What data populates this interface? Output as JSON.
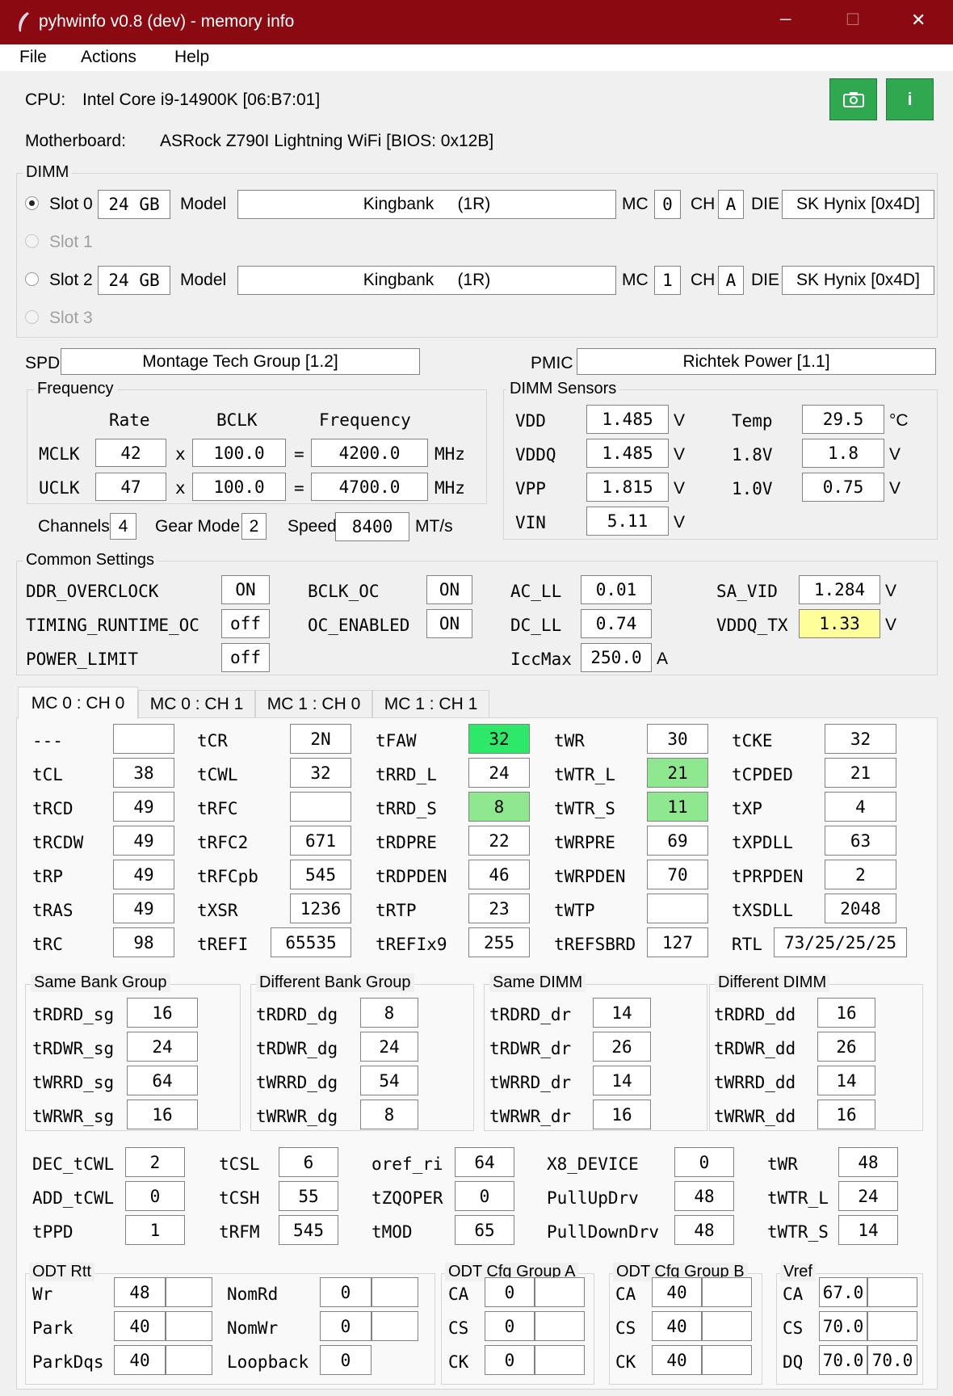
{
  "window": {
    "title": "pyhwinfo v0.8 (dev) - memory info",
    "min": "─",
    "max": "☐",
    "close": "✕"
  },
  "menu": [
    "File",
    "Actions",
    "Help"
  ],
  "cpu": {
    "label": "CPU:",
    "value": "Intel Core i9-14900K  [06:B7:01]"
  },
  "board": {
    "label": "Motherboard:",
    "value": "ASRock Z790I Lightning WiFi  [BIOS: 0x12B]"
  },
  "buttons": {
    "screenshot_icon": "camera-icon",
    "info_label": "i",
    "color": "#2fa84f"
  },
  "dimm": {
    "title": "DIMM",
    "slots": [
      {
        "label": "Slot 0",
        "size": "24  GB",
        "model_label": "Model",
        "model": "Kingbank     (1R)",
        "mc_label": "MC",
        "mc": "0",
        "ch_label": "CH",
        "ch": "A",
        "die_label": "DIE",
        "die": "SK Hynix [0x4D]"
      },
      {
        "label": "Slot 1"
      },
      {
        "label": "Slot 2",
        "size": "24  GB",
        "model_label": "Model",
        "model": "Kingbank     (1R)",
        "mc_label": "MC",
        "mc": "1",
        "ch_label": "CH",
        "ch": "A",
        "die_label": "DIE",
        "die": "SK Hynix [0x4D]"
      },
      {
        "label": "Slot 3"
      }
    ]
  },
  "spd": {
    "label": "SPD",
    "value": "Montage Tech Group [1.2]"
  },
  "pmic": {
    "label": "PMIC",
    "value": "Richtek Power [1.1]"
  },
  "freq": {
    "title": "Frequency",
    "h_rate": "Rate",
    "h_bclk": "BCLK",
    "h_freq": "Frequency",
    "x": "x",
    "eq": "=",
    "unit": "MHz",
    "rows": [
      {
        "label": "MCLK",
        "rate": "42",
        "bclk": "100.0",
        "freq": "4200.0"
      },
      {
        "label": "UCLK",
        "rate": "47",
        "bclk": "100.0",
        "freq": "4700.0"
      }
    ],
    "channels_label": "Channels",
    "channels": "4",
    "gear_label": "Gear Mode",
    "gear": "2",
    "speed_label": "Speed",
    "speed": "8400",
    "speed_unit": "MT/s"
  },
  "sensors": {
    "title": "DIMM Sensors",
    "left": [
      {
        "l": "VDD",
        "v": "1.485",
        "u": "V"
      },
      {
        "l": "VDDQ",
        "v": "1.485",
        "u": "V"
      },
      {
        "l": "VPP",
        "v": "1.815",
        "u": "V"
      },
      {
        "l": "VIN",
        "v": "5.11",
        "u": "V"
      }
    ],
    "right": [
      {
        "l": "Temp",
        "v": "29.5",
        "u": "°C"
      },
      {
        "l": "1.8V",
        "v": "1.8",
        "u": "V"
      },
      {
        "l": "1.0V",
        "v": "0.75",
        "u": "V"
      }
    ]
  },
  "common": {
    "title": "Common Settings",
    "ddr_oc": {
      "l": "DDR_OVERCLOCK",
      "v": "ON"
    },
    "trt": {
      "l": "TIMING_RUNTIME_OC",
      "v": "off"
    },
    "pl": {
      "l": "POWER_LIMIT",
      "v": "off"
    },
    "bclk": {
      "l": "BCLK_OC",
      "v": "ON"
    },
    "oce": {
      "l": "OC_ENABLED",
      "v": "ON"
    },
    "acll": {
      "l": "AC_LL",
      "v": "0.01"
    },
    "dcll": {
      "l": "DC_LL",
      "v": "0.74"
    },
    "icc": {
      "l": "IccMax",
      "v": "250.0",
      "u": "A"
    },
    "savid": {
      "l": "SA_VID",
      "v": "1.284",
      "u": "V"
    },
    "vddqtx": {
      "l": "VDDQ_TX",
      "v": "1.33",
      "u": "V",
      "color": "#ffff99"
    }
  },
  "tabs": [
    "MC 0 : CH 0",
    "MC 0 : CH 1",
    "MC 1 : CH 0",
    "MC 1 : CH 1"
  ],
  "timings": [
    [
      {
        "l": "---",
        "v": ""
      },
      {
        "l": "tCL",
        "v": "38"
      },
      {
        "l": "tRCD",
        "v": "49"
      },
      {
        "l": "tRCDW",
        "v": "49"
      },
      {
        "l": "tRP",
        "v": "49"
      },
      {
        "l": "tRAS",
        "v": "49"
      },
      {
        "l": "tRC",
        "v": "98"
      }
    ],
    [
      {
        "l": "tCR",
        "v": "2N"
      },
      {
        "l": "tCWL",
        "v": "32"
      },
      {
        "l": "tRFC",
        "v": ""
      },
      {
        "l": "tRFC2",
        "v": "671"
      },
      {
        "l": "tRFCpb",
        "v": "545"
      },
      {
        "l": "tXSR",
        "v": "1236"
      },
      {
        "l": "tREFI",
        "v": "65535"
      }
    ],
    [
      {
        "l": "tFAW",
        "v": "32",
        "hl": "#2ee86a"
      },
      {
        "l": "tRRD_L",
        "v": "24"
      },
      {
        "l": "tRRD_S",
        "v": "8",
        "hl": "#8fe88f"
      },
      {
        "l": "tRDPRE",
        "v": "22"
      },
      {
        "l": "tRDPDEN",
        "v": "46"
      },
      {
        "l": "tRTP",
        "v": "23"
      },
      {
        "l": "tREFIx9",
        "v": "255"
      }
    ],
    [
      {
        "l": "tWR",
        "v": "30"
      },
      {
        "l": "tWTR_L",
        "v": "21",
        "hl": "#8fe88f"
      },
      {
        "l": "tWTR_S",
        "v": "11",
        "hl": "#8fe88f"
      },
      {
        "l": "tWRPRE",
        "v": "69"
      },
      {
        "l": "tWRPDEN",
        "v": "70"
      },
      {
        "l": "tWTP",
        "v": ""
      },
      {
        "l": "tREFSBRD",
        "v": "127"
      }
    ],
    [
      {
        "l": "tCKE",
        "v": "32"
      },
      {
        "l": "tCPDED",
        "v": "21"
      },
      {
        "l": "tXP",
        "v": "4"
      },
      {
        "l": "tXPDLL",
        "v": "63"
      },
      {
        "l": "tPRPDEN",
        "v": "2"
      },
      {
        "l": "tXSDLL",
        "v": "2048"
      },
      {
        "l": "RTL",
        "v": "73/25/25/25"
      }
    ]
  ],
  "turn": [
    {
      "title": "Same Bank Group",
      "rows": [
        {
          "l": "tRDRD_sg",
          "v": "16"
        },
        {
          "l": "tRDWR_sg",
          "v": "24"
        },
        {
          "l": "tWRRD_sg",
          "v": "64"
        },
        {
          "l": "tWRWR_sg",
          "v": "16"
        }
      ]
    },
    {
      "title": "Different Bank Group",
      "rows": [
        {
          "l": "tRDRD_dg",
          "v": "8"
        },
        {
          "l": "tRDWR_dg",
          "v": "24"
        },
        {
          "l": "tWRRD_dg",
          "v": "54"
        },
        {
          "l": "tWRWR_dg",
          "v": "8"
        }
      ]
    },
    {
      "title": "Same DIMM",
      "rows": [
        {
          "l": "tRDRD_dr",
          "v": "14"
        },
        {
          "l": "tRDWR_dr",
          "v": "26"
        },
        {
          "l": "tWRRD_dr",
          "v": "14"
        },
        {
          "l": "tWRWR_dr",
          "v": "16"
        }
      ]
    },
    {
      "title": "Different DIMM",
      "rows": [
        {
          "l": "tRDRD_dd",
          "v": "16"
        },
        {
          "l": "tRDWR_dd",
          "v": "26"
        },
        {
          "l": "tWRRD_dd",
          "v": "14"
        },
        {
          "l": "tWRWR_dd",
          "v": "16"
        }
      ]
    }
  ],
  "misc": [
    [
      {
        "l": "DEC_tCWL",
        "v": "2"
      },
      {
        "l": "ADD_tCWL",
        "v": "0"
      },
      {
        "l": "tPPD",
        "v": "1"
      }
    ],
    [
      {
        "l": "tCSL",
        "v": "6"
      },
      {
        "l": "tCSH",
        "v": "55"
      },
      {
        "l": "tRFM",
        "v": "545"
      }
    ],
    [
      {
        "l": "oref_ri",
        "v": "64"
      },
      {
        "l": "tZQOPER",
        "v": "0"
      },
      {
        "l": "tMOD",
        "v": "65"
      }
    ],
    [
      {
        "l": "X8_DEVICE",
        "v": "0"
      },
      {
        "l": "PullUpDrv",
        "v": "48"
      },
      {
        "l": "PullDownDrv",
        "v": "48"
      }
    ],
    [
      {
        "l": "tWR",
        "v": "48"
      },
      {
        "l": "tWTR_L",
        "v": "24"
      },
      {
        "l": "tWTR_S",
        "v": "14"
      }
    ]
  ],
  "odt": {
    "title": "ODT Rtt",
    "left": [
      {
        "l": "Wr",
        "v": "48",
        "v2": ""
      },
      {
        "l": "Park",
        "v": "40",
        "v2": ""
      },
      {
        "l": "ParkDqs",
        "v": "40",
        "v2": ""
      }
    ],
    "right": [
      {
        "l": "NomRd",
        "v": "0",
        "v2": ""
      },
      {
        "l": "NomWr",
        "v": "0",
        "v2": ""
      },
      {
        "l": "Loopback",
        "v": "0"
      }
    ]
  },
  "odt_a": {
    "title": "ODT Cfg Group A",
    "rows": [
      {
        "l": "CA",
        "v": "0",
        "v2": ""
      },
      {
        "l": "CS",
        "v": "0",
        "v2": ""
      },
      {
        "l": "CK",
        "v": "0",
        "v2": ""
      }
    ]
  },
  "odt_b": {
    "title": "ODT Cfg Group B",
    "rows": [
      {
        "l": "CA",
        "v": "40",
        "v2": ""
      },
      {
        "l": "CS",
        "v": "40",
        "v2": ""
      },
      {
        "l": "CK",
        "v": "40",
        "v2": ""
      }
    ]
  },
  "vref": {
    "title": "Vref",
    "rows": [
      {
        "l": "CA",
        "v": "67.0",
        "v2": ""
      },
      {
        "l": "CS",
        "v": "70.0",
        "v2": ""
      },
      {
        "l": "DQ",
        "v": "70.0",
        "v2": "70.0"
      }
    ]
  }
}
